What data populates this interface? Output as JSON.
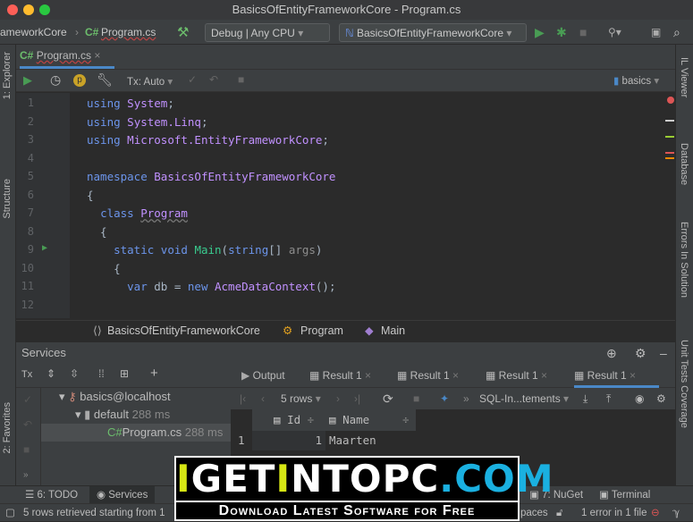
{
  "window": {
    "title": "BasicsOfEntityFrameworkCore - Program.cs"
  },
  "toolbar": {
    "breadcrumb_project": "ameworkCore",
    "breadcrumb_file": "Program.cs",
    "config": "Debug | Any CPU",
    "run_target": "BasicsOfEntityFrameworkCore"
  },
  "left_stripe": [
    "1: Explorer",
    "Structure",
    "2: Favorites"
  ],
  "right_stripe": [
    "IL Viewer",
    "Database",
    "Errors In Solution",
    "Unit Tests Coverage"
  ],
  "editor": {
    "tab": "Program.cs",
    "tx_mode": "Tx: Auto",
    "datasource": "basics",
    "lines": [
      {
        "n": "1",
        "html": "<span class='kw'>using</span> <span class='ty'>System</span>;"
      },
      {
        "n": "2",
        "html": "<span class='kw'>using</span> <span class='ty'>System.Linq</span>;"
      },
      {
        "n": "3",
        "html": "<span class='kw'>using</span> <span class='ty'>Microsoft.EntityFrameworkCore</span>;"
      },
      {
        "n": "4",
        "html": ""
      },
      {
        "n": "5",
        "html": "<span class='kw'>namespace</span> <span class='ty'>BasicsOfEntityFrameworkCore</span>"
      },
      {
        "n": "6",
        "html": "{"
      },
      {
        "n": "7",
        "html": "  <span class='kw'>class</span> <span class='ty' style='text-decoration:underline wavy #777'>Program</span>"
      },
      {
        "n": "8",
        "html": "  {"
      },
      {
        "n": "9",
        "html": "    <span class='kw'>static void</span> <span class='fn'>Main</span>(<span class='kw'>string</span>[] <span class='pm'>args</span>)"
      },
      {
        "n": "10",
        "html": "    {"
      },
      {
        "n": "11",
        "html": "      <span class='kw'>var</span> db = <span class='kw'>new</span> <span class='ty'>AcmeDataContext</span>();"
      },
      {
        "n": "12",
        "html": ""
      }
    ]
  },
  "breadcrumb": {
    "namespace": "BasicsOfEntityFrameworkCore",
    "class": "Program",
    "method": "Main"
  },
  "services": {
    "title": "Services",
    "tree": [
      {
        "label": "basics@localhost",
        "time": ""
      },
      {
        "label": "default",
        "time": "288 ms"
      },
      {
        "label": "Program.cs",
        "time": "288 ms"
      }
    ],
    "tabs": [
      "Output",
      "Result 1",
      "Result 1",
      "Result 1",
      "Result 1"
    ],
    "rows_label": "5 rows",
    "sql_mode": "SQL-In...tements",
    "columns": [
      "Id",
      "Name"
    ],
    "rows": [
      {
        "idx": "1",
        "id": "1",
        "name": "Maarten"
      }
    ]
  },
  "bottom_tabs": [
    "6: TODO",
    "Services",
    "7: NuGet",
    "Terminal"
  ],
  "status": {
    "message": "5 rows retrieved starting from 1",
    "spaces": "paces",
    "errors": "1 error in 1 file"
  },
  "watermark": {
    "brand": "IGetIntoPC.com",
    "tagline": "Download Latest Software for Free"
  },
  "colors": {
    "keyword": "#6c95eb",
    "type": "#c191ff",
    "method": "#39cc8f",
    "run": "#499c54"
  }
}
